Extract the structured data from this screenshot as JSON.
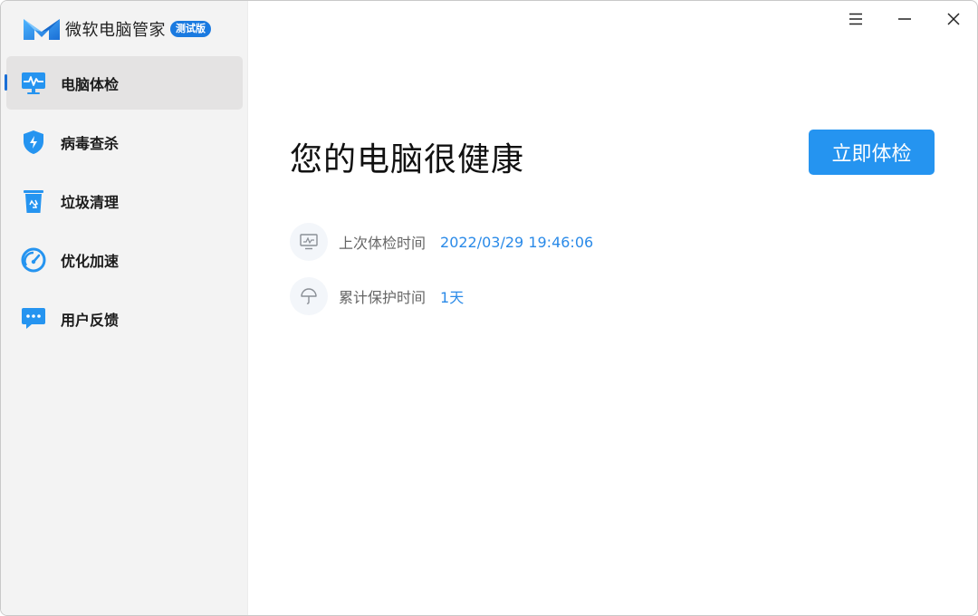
{
  "app": {
    "name": "微软电脑管家",
    "badge": "测试版"
  },
  "sidebar": {
    "items": [
      {
        "label": "电脑体检",
        "icon": "monitor-pulse-icon",
        "active": true
      },
      {
        "label": "病毒查杀",
        "icon": "shield-bolt-icon",
        "active": false
      },
      {
        "label": "垃圾清理",
        "icon": "recycle-bin-icon",
        "active": false
      },
      {
        "label": "优化加速",
        "icon": "speedometer-icon",
        "active": false
      },
      {
        "label": "用户反馈",
        "icon": "chat-bubble-icon",
        "active": false
      }
    ]
  },
  "titlebar": {
    "buttons": [
      "menu-icon",
      "minimize-icon",
      "close-icon"
    ]
  },
  "main": {
    "headline": "您的电脑很健康",
    "check_button": "立即体检",
    "info": [
      {
        "label": "上次体检时间",
        "value": "2022/03/29 19:46:06",
        "icon": "monitor-icon"
      },
      {
        "label": "累计保护时间",
        "value": "1天",
        "icon": "umbrella-icon"
      }
    ]
  },
  "colors": {
    "accent": "#2594f0",
    "accent_dark": "#1a6fd6",
    "sidebar_bg": "#f3f3f3",
    "active_item_bg": "#e4e3e3",
    "value_text": "#2a8ae8"
  }
}
